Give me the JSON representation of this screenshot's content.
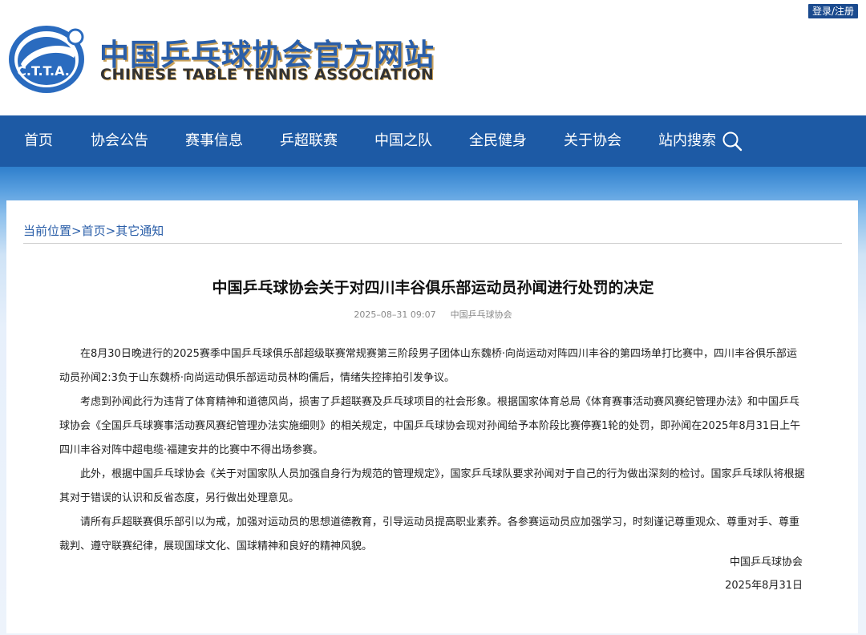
{
  "header": {
    "login_label": "登录/注册",
    "title_cn": "中国乒乓球协会官方网站",
    "title_en": "CHINESE TABLE TENNIS ASSOCIATION",
    "logo_text": "C.T.T.A."
  },
  "nav": {
    "items": [
      "首页",
      "协会公告",
      "赛事信息",
      "乒超联赛",
      "中国之队",
      "全民健身",
      "关于协会",
      "站内搜索"
    ]
  },
  "breadcrumb": {
    "prefix": "当前位置",
    "items": [
      "首页",
      "其它通知"
    ],
    "separator": ">"
  },
  "article": {
    "title": "中国乒乓球协会关于对四川丰谷俱乐部运动员孙闻进行处罚的决定",
    "date": "2025–08–31 09:07",
    "source": "中国乒乓球协会",
    "paragraphs": [
      "在8月30日晚进行的2025赛季中国乒乓球俱乐部超级联赛常规赛第三阶段男子团体山东魏桥·向尚运动对阵四川丰谷的第四场单打比赛中，四川丰谷俱乐部运动员孙闻2:3负于山东魏桥·向尚运动俱乐部运动员林昀儒后，情绪失控摔拍引发争议。",
      "考虑到孙闻此行为违背了体育精神和道德风尚，损害了乒超联赛及乒乓球项目的社会形象。根据国家体育总局《体育赛事活动赛风赛纪管理办法》和中国乒乓球协会《全国乒乓球赛事活动赛风赛纪管理办法实施细则》的相关规定，中国乒乓球协会现对孙闻给予本阶段比赛停赛1轮的处罚，即孙闻在2025年8月31日上午四川丰谷对阵中超电缆·福建安井的比赛中不得出场参赛。",
      "此外，根据中国乒乓球协会《关于对国家队人员加强自身行为规范的管理规定》，国家乒乓球队要求孙闻对于自己的行为做出深刻的检讨。国家乒乓球队将根据其对于错误的认识和反省态度，另行做出处理意见。",
      "请所有乒超联赛俱乐部引以为戒，加强对运动员的思想道德教育，引导运动员提高职业素养。各参赛运动员应加强学习，时刻谨记尊重观众、尊重对手、尊重裁判、遵守联赛纪律，展现国球文化、国球精神和良好的精神风貌。"
    ],
    "signature": "中国乒乓球协会",
    "sign_date": "2025年8月31日"
  },
  "colors": {
    "nav_bg": "#1d5aa5",
    "brand_blue": "#2a5ea8",
    "title_shadow": "#c9a15a"
  },
  "icons": {
    "logo": "ctta-logo-icon",
    "search": "search-icon"
  }
}
